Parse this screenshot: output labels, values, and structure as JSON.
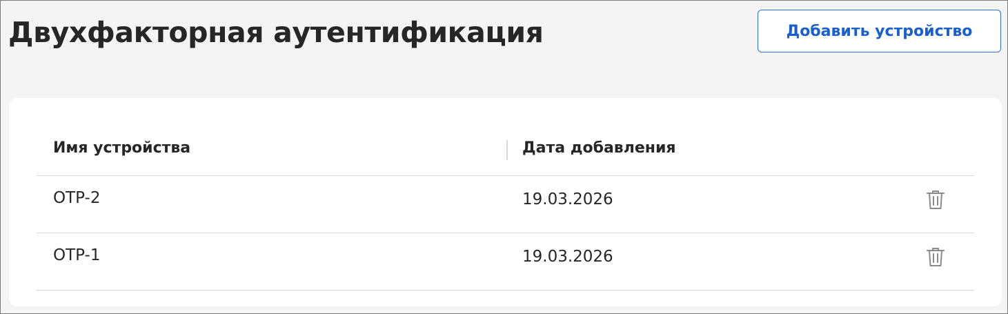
{
  "header": {
    "title": "Двухфакторная аутентификация",
    "add_device_label": "Добавить устройство"
  },
  "table": {
    "columns": [
      "Имя устройства",
      "Дата добавления"
    ],
    "rows": [
      {
        "name": "OTP-2",
        "date": "19.03.2026",
        "action_icon": "trash-icon"
      },
      {
        "name": "OTP-1",
        "date": "19.03.2026",
        "action_icon": "trash-icon"
      }
    ]
  },
  "colors": {
    "accent": "#1a5fd1",
    "page_background": "#f4f4f4",
    "card_background": "#ffffff",
    "text": "#262626",
    "divider": "#d9d9d9",
    "icon": "#8a8a8a"
  }
}
